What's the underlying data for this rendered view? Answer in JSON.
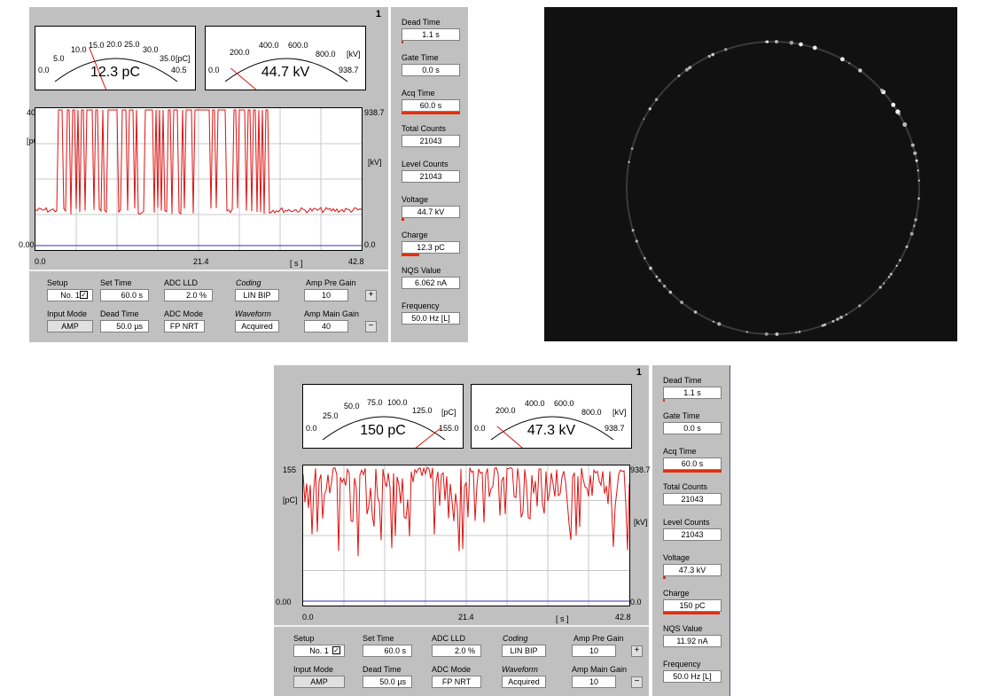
{
  "panels": [
    {
      "id": "top",
      "panel_number": "1",
      "charge_gauge": {
        "ticks": [
          "0.0",
          "5.0",
          "10.0",
          "15.0",
          "20.0",
          "25.0",
          "30.0",
          "35.0",
          "40.5"
        ],
        "unit": "[pC]",
        "value_text": "12.3 pC",
        "value": 12.3,
        "max": 40.5
      },
      "voltage_gauge": {
        "ticks": [
          "0.0",
          "200.0",
          "400.0",
          "600.0",
          "800.0",
          "938.7"
        ],
        "unit": "[kV]",
        "value_text": "44.7 kV",
        "value": 44.7,
        "max": 938.7
      },
      "plot": {
        "y_left_max": "40.5",
        "y_left_min": "0.00",
        "y_left_unit": "[pC]",
        "y_right_max": "938.7",
        "y_right_min": "0.0",
        "y_right_unit": "[kV]",
        "x_ticks": [
          "0.0",
          "21.4",
          "42.8"
        ],
        "x_unit": "[ s ]"
      },
      "sidebar": [
        {
          "label": "Dead Time",
          "value": "1.1 s",
          "bar": 0.02
        },
        {
          "label": "Gate Time",
          "value": "0.0 s",
          "bar": 0
        },
        {
          "label": "Acq Time",
          "value": "60.0 s",
          "bar": 1.0
        },
        {
          "label": "Total Counts",
          "value": "21043",
          "bar": 0
        },
        {
          "label": "Level Counts",
          "value": "21043",
          "bar": 0
        },
        {
          "label": "Voltage",
          "value": "44.7 kV",
          "bar": 0.05
        },
        {
          "label": "Charge",
          "value": "12.3 pC",
          "bar": 0.3
        },
        {
          "label": "NQS Value",
          "value": "6.062 nA",
          "bar": 0
        },
        {
          "label": "Frequency",
          "value": "50.0 Hz [L]",
          "bar": 0
        }
      ],
      "settings": {
        "setup_label": "Setup",
        "setup_value": "No. 1",
        "setup_check": "✓",
        "set_time_label": "Set Time",
        "set_time_value": "60.0  s",
        "adc_lld_label": "ADC LLD",
        "adc_lld_value": "2.0 %",
        "coding_label": "Coding",
        "coding_value": "LIN BIP",
        "pre_gain_label": "Amp Pre Gain",
        "pre_gain_value": "10",
        "pre_gain_btn": "+",
        "input_mode_label": "Input Mode",
        "input_mode_value": "AMP",
        "dead_time_label": "Dead Time",
        "dead_time_value": "50.0 µs",
        "adc_mode_label": "ADC Mode",
        "adc_mode_value": "FP NRT",
        "waveform_label": "Waveform",
        "waveform_value": "Acquired",
        "main_gain_label": "Amp Main Gain",
        "main_gain_value": "40",
        "main_gain_btn": "−"
      }
    },
    {
      "id": "bottom",
      "panel_number": "1",
      "charge_gauge": {
        "ticks": [
          "0.0",
          "25.0",
          "50.0",
          "75.0",
          "100.0",
          "125.0",
          "155.0"
        ],
        "unit": "[pC]",
        "value_text": "150 pC",
        "value": 150,
        "max": 155
      },
      "voltage_gauge": {
        "ticks": [
          "0.0",
          "200.0",
          "400.0",
          "600.0",
          "800.0",
          "938.7"
        ],
        "unit": "[kV]",
        "value_text": "47.3 kV",
        "value": 47.3,
        "max": 938.7
      },
      "plot": {
        "y_left_max": "155",
        "y_left_min": "0.00",
        "y_left_unit": "[pC]",
        "y_right_max": "938.7",
        "y_right_min": "0.0",
        "y_right_unit": "[kV]",
        "x_ticks": [
          "0.0",
          "21.4",
          "42.8"
        ],
        "x_unit": "[ s ]"
      },
      "sidebar": [
        {
          "label": "Dead Time",
          "value": "1.1 s",
          "bar": 0.02
        },
        {
          "label": "Gate Time",
          "value": "0.0 s",
          "bar": 0
        },
        {
          "label": "Acq Time",
          "value": "60.0 s",
          "bar": 1.0
        },
        {
          "label": "Total Counts",
          "value": "21043",
          "bar": 0
        },
        {
          "label": "Level Counts",
          "value": "21043",
          "bar": 0
        },
        {
          "label": "Voltage",
          "value": "47.3 kV",
          "bar": 0.05
        },
        {
          "label": "Charge",
          "value": "150 pC",
          "bar": 0.97
        },
        {
          "label": "NQS Value",
          "value": "11.92 nA",
          "bar": 0
        },
        {
          "label": "Frequency",
          "value": "50.0 Hz [L]",
          "bar": 0
        }
      ],
      "settings": {
        "setup_label": "Setup",
        "setup_value": "No. 1",
        "setup_check": "✓",
        "set_time_label": "Set Time",
        "set_time_value": "60.0  s",
        "adc_lld_label": "ADC LLD",
        "adc_lld_value": "2.0 %",
        "coding_label": "Coding",
        "coding_value": "LIN BIP",
        "pre_gain_label": "Amp Pre Gain",
        "pre_gain_value": "10",
        "pre_gain_btn": "+",
        "input_mode_label": "Input Mode",
        "input_mode_value": "AMP",
        "dead_time_label": "Dead Time",
        "dead_time_value": "50.0 µs",
        "adc_mode_label": "ADC Mode",
        "adc_mode_value": "FP NRT",
        "waveform_label": "Waveform",
        "waveform_value": "Acquired",
        "main_gain_label": "Amp Main Gain",
        "main_gain_value": "10",
        "main_gain_btn": "−"
      }
    }
  ],
  "colors": {
    "trace": "#e01010",
    "voltage_trace": "#3030c0",
    "bar": "#e03010",
    "panel": "#c0c0c0"
  },
  "photo": {
    "type": "discharge-ring-image"
  }
}
